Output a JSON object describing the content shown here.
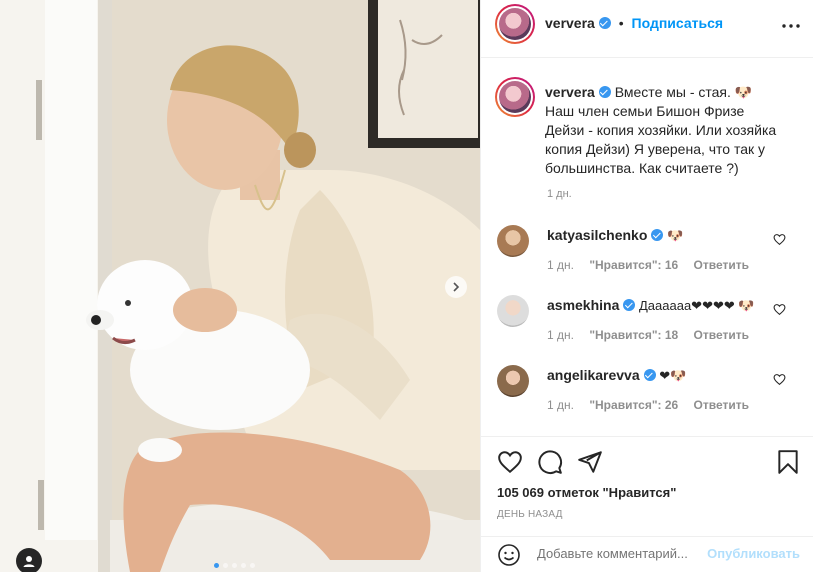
{
  "post": {
    "author": "ververa",
    "follow_label": "Подписаться",
    "header_separator": "•",
    "more_icon": "more-horizontal-icon",
    "caption_lines": [
      "Вместе мы - стая. 🐶",
      "Наш член семьи Бишон Фризе",
      "Дейзи - копия хозяйки. Или хозяйка",
      "копия Дейзи) Я уверена, что так у",
      "большинства. Как считаете ?)"
    ],
    "caption_time": "1 дн.",
    "likes_text": "105 069 отметок \"Нравится\"",
    "posted_ago": "ДЕНЬ НАЗАД",
    "carousel": {
      "total": 5,
      "active": 1
    }
  },
  "comments": [
    {
      "user": "katyasilchenko",
      "text": "🐶",
      "time": "1 дн.",
      "likes": "\"Нравится\": 16",
      "reply": "Ответить"
    },
    {
      "user": "asmekhina",
      "text": "Даааааа❤❤❤❤ 🐶",
      "time": "1 дн.",
      "likes": "\"Нравится\": 18",
      "reply": "Ответить"
    },
    {
      "user": "angelikarevva",
      "text": "❤🐶",
      "time": "1 дн.",
      "likes": "\"Нравится\": 26",
      "reply": "Ответить"
    }
  ],
  "add_comment": {
    "placeholder": "Добавьте комментарий...",
    "post_label": "Опубликовать"
  },
  "colors": {
    "accent": "#0095f6",
    "verified": "#3897f0",
    "muted": "#8e8e8e"
  }
}
